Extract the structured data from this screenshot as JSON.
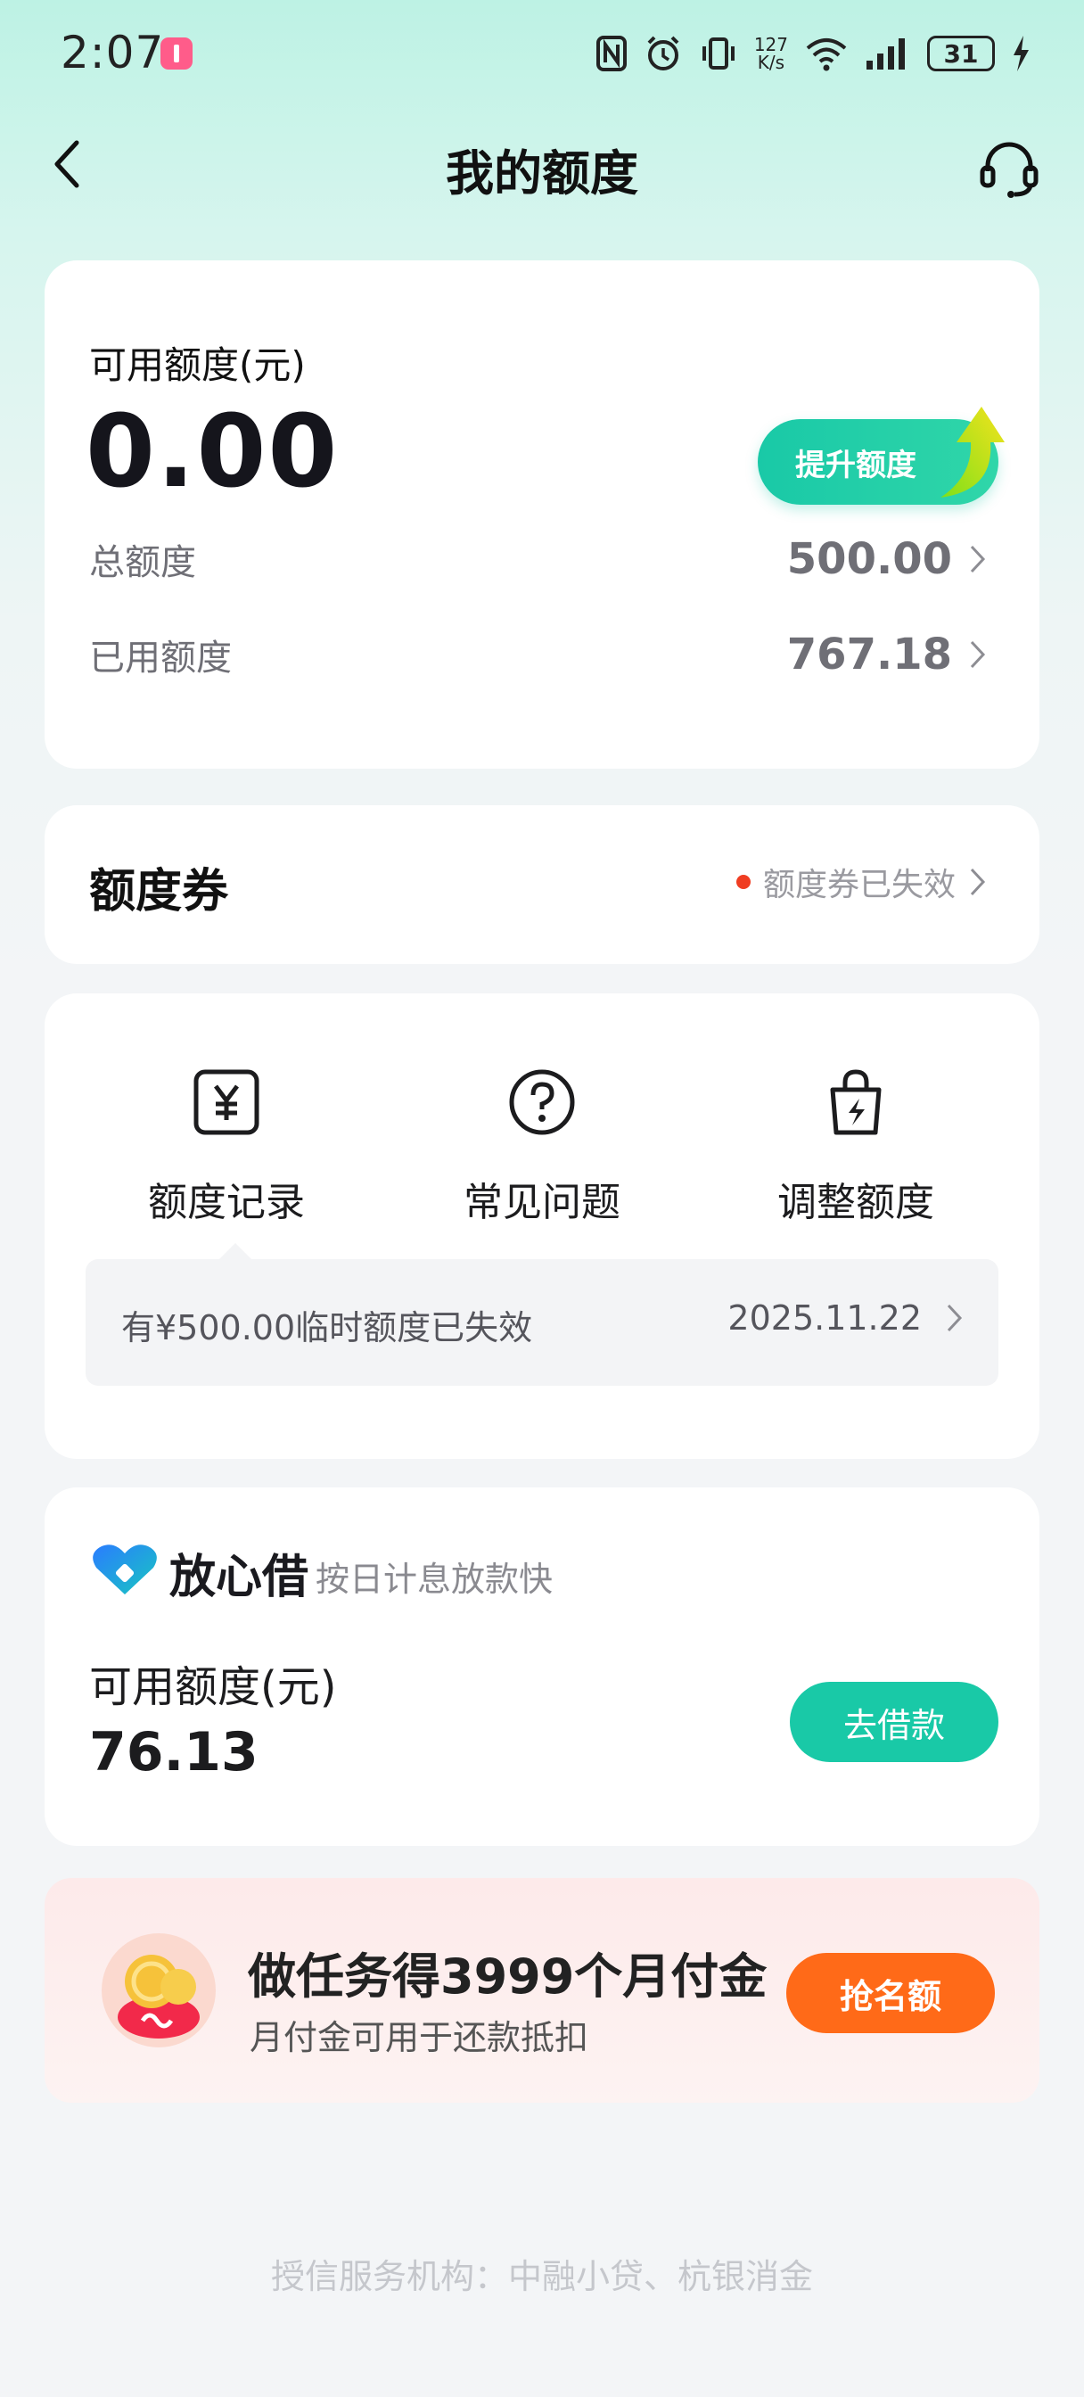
{
  "status_bar": {
    "time": "2:07",
    "net_speed_top": "127",
    "net_speed_bottom": "K/s",
    "battery": "31",
    "icons": [
      "nfc-icon",
      "alarm-icon",
      "vibrate-icon",
      "wifi-icon",
      "signal-icon",
      "charging-icon"
    ]
  },
  "nav": {
    "title": "我的额度",
    "back_icon": "chevron-left-icon",
    "service_icon": "headset-icon"
  },
  "quota": {
    "available_label": "可用额度(元)",
    "available_value": "0.00",
    "raise_button": "提升额度",
    "total_label": "总额度",
    "total_value": "500.00",
    "used_label": "已用额度",
    "used_value": "767.18"
  },
  "coupon": {
    "title": "额度券",
    "status": "额度券已失效"
  },
  "shortcuts": [
    {
      "label": "额度记录",
      "icon": "yuan-record-icon"
    },
    {
      "label": "常见问题",
      "icon": "question-icon"
    },
    {
      "label": "调整额度",
      "icon": "lightning-bag-icon"
    }
  ],
  "notice": {
    "text": "有¥500.00临时额度已失效",
    "date": "2025.11.22"
  },
  "loan": {
    "brand": "放心借",
    "tagline": "按日计息放款快",
    "available_label": "可用额度(元)",
    "available_value": "76.13",
    "button": "去借款"
  },
  "promo": {
    "title": "做任务得3999个月付金",
    "subtitle": "月付金可用于还款抵扣",
    "button": "抢名额"
  },
  "footer": "授信服务机构：中融小贷、杭银消金",
  "colors": {
    "accent": "#19c9a7",
    "promo_button": "#ff6a18",
    "alert_dot": "#f03d22"
  }
}
